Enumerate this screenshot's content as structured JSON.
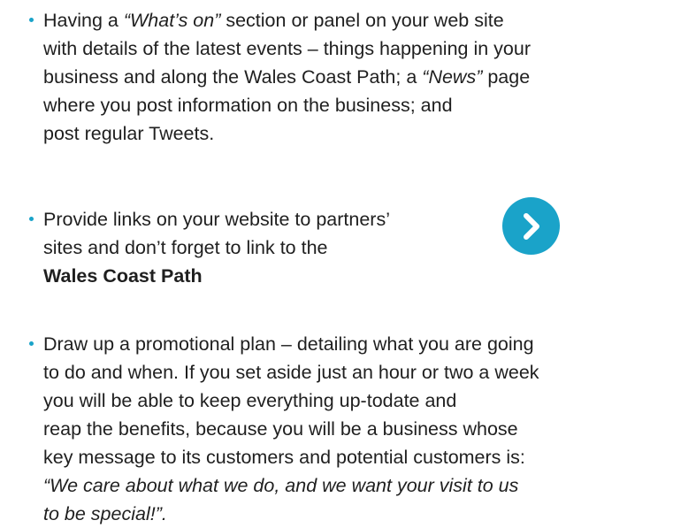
{
  "bullet1": {
    "l1_pre": "Having a ",
    "l1_em": "“What’s on”",
    "l1_post": " section  or panel on your web site",
    "l2": "with details of the latest events – things happening in your",
    "l3_pre": "business and along the Wales Coast Path; a ",
    "l3_em": "“News”",
    "l3_post": " page",
    "l4": "where you post information on the business; and",
    "l5": "post regular Tweets."
  },
  "bullet2": {
    "l1": "Provide links on your website to partners’",
    "l2": "sites and don’t forget to link to the",
    "l3_strong": "Wales Coast Path"
  },
  "bullet3": {
    "l1": "Draw up a promotional plan – detailing what you are going",
    "l2": "to do and when. If you set aside just an hour or two a week",
    "l3": "you will be able to keep everything up-todate and",
    "l4": "reap the benefits, because you will be a business whose",
    "l5": "key message to its customers and potential customers is:",
    "l6_em": "“We care about what we do, and we want your visit to us",
    "l7_em": "to be special!”."
  },
  "link_button": {
    "icon": "chevron-right-icon",
    "color": "#1aa3c9"
  },
  "colors": {
    "accent": "#1aa3c9",
    "text": "#1f1f1f"
  }
}
